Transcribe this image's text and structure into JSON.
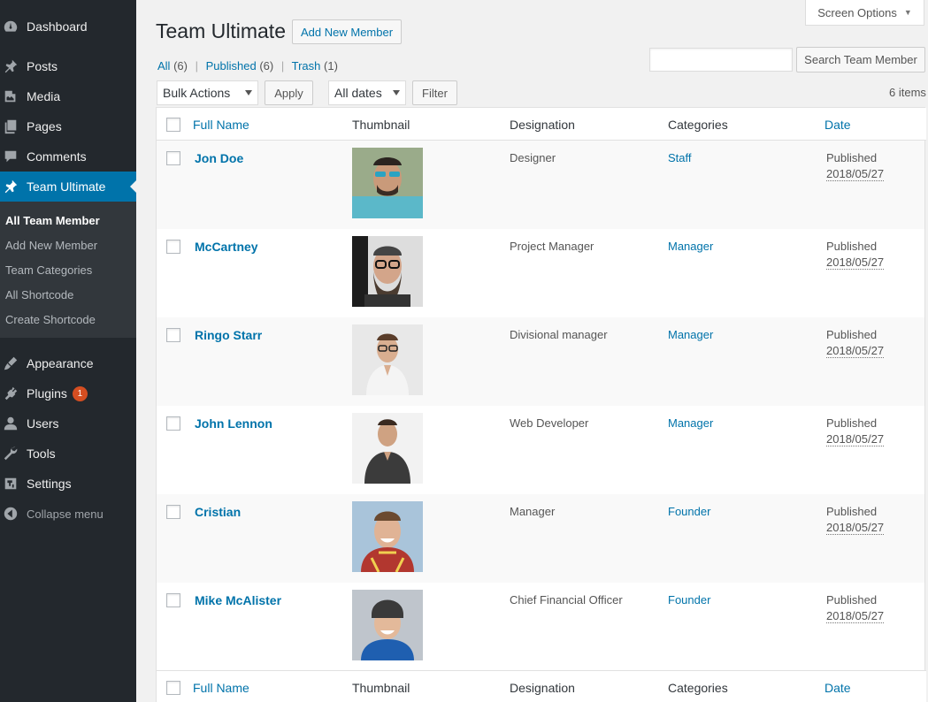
{
  "sidebar": {
    "items": [
      {
        "label": "Dashboard",
        "icon": "dashboard-icon"
      },
      {
        "label": "Posts",
        "icon": "pin-icon"
      },
      {
        "label": "Media",
        "icon": "media-icon"
      },
      {
        "label": "Pages",
        "icon": "pages-icon"
      },
      {
        "label": "Comments",
        "icon": "comment-icon"
      },
      {
        "label": "Team Ultimate",
        "icon": "pin-icon"
      },
      {
        "label": "Appearance",
        "icon": "brush-icon"
      },
      {
        "label": "Plugins",
        "icon": "plugin-icon",
        "badge": "1"
      },
      {
        "label": "Users",
        "icon": "user-icon"
      },
      {
        "label": "Tools",
        "icon": "wrench-icon"
      },
      {
        "label": "Settings",
        "icon": "settings-icon"
      },
      {
        "label": "Collapse menu",
        "icon": "collapse-icon"
      }
    ],
    "submenu": [
      "All Team Member",
      "Add New Member",
      "Team Categories",
      "All Shortcode",
      "Create Shortcode"
    ]
  },
  "header": {
    "screen_options": "Screen Options",
    "title": "Team Ultimate",
    "add_new": "Add New Member"
  },
  "views": {
    "all": "All",
    "all_count": "(6)",
    "published": "Published",
    "published_count": "(6)",
    "trash": "Trash",
    "trash_count": "(1)",
    "separator": "|"
  },
  "search": {
    "value": "",
    "button": "Search Team Member"
  },
  "actions": {
    "bulk": "Bulk Actions",
    "apply": "Apply",
    "dates": "All dates",
    "filter": "Filter",
    "items_count": "6 items"
  },
  "table": {
    "columns": [
      "Full Name",
      "Thumbnail",
      "Designation",
      "Categories",
      "Date"
    ],
    "rows": [
      {
        "name": "Jon Doe",
        "designation": "Designer",
        "category": "Staff",
        "status": "Published",
        "date": "2018/05/27"
      },
      {
        "name": "McCartney",
        "designation": "Project Manager",
        "category": "Manager",
        "status": "Published",
        "date": "2018/05/27"
      },
      {
        "name": "Ringo Starr",
        "designation": "Divisional manager",
        "category": "Manager",
        "status": "Published",
        "date": "2018/05/27"
      },
      {
        "name": "John Lennon",
        "designation": "Web Developer",
        "category": "Manager",
        "status": "Published",
        "date": "2018/05/27"
      },
      {
        "name": "Cristian",
        "designation": "Manager",
        "category": "Founder",
        "status": "Published",
        "date": "2018/05/27"
      },
      {
        "name": "Mike McAlister",
        "designation": "Chief Financial Officer",
        "category": "Founder",
        "status": "Published",
        "date": "2018/05/27"
      }
    ]
  },
  "colors": {
    "sidebar": "#23282d",
    "accent": "#0073aa",
    "badge": "#d54e21"
  }
}
